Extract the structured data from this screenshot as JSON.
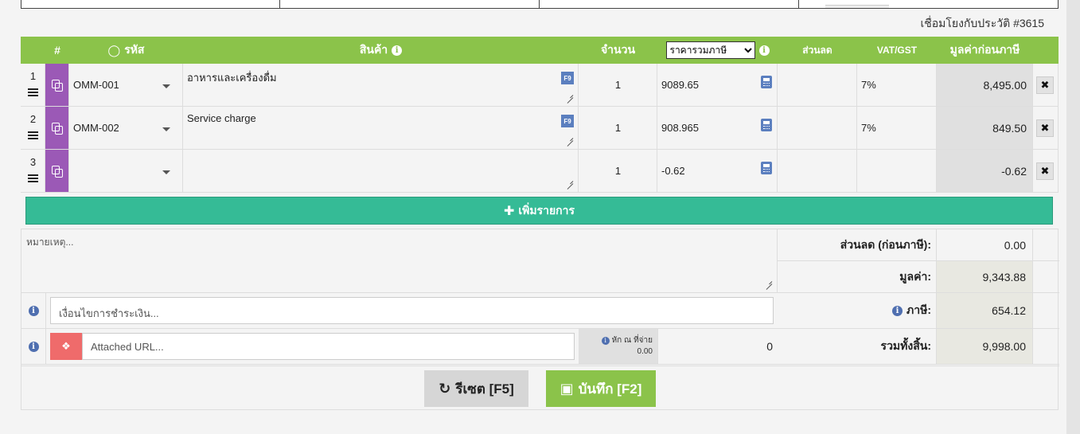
{
  "history_link": "เชื่อมโยงกับประวัติ #3615",
  "header": {
    "hash": "#",
    "code": "รหัส",
    "product": "สินค้า",
    "qty": "จำนวน",
    "price_mode_selected": "ราคารวมภาษี",
    "discount": "ส่วนลด",
    "vat": "VAT/GST",
    "amount": "มูลค่าก่อนภาษี"
  },
  "rows": [
    {
      "no": "1",
      "code": "OMM-001",
      "product": "อาหารและเครื่องดื่ม",
      "qty": "1",
      "price": "9089.65",
      "discount": "",
      "vat": "7%",
      "amount": "8,495.00",
      "f9": "F9"
    },
    {
      "no": "2",
      "code": "OMM-002",
      "product": "Service charge",
      "qty": "1",
      "price": "908.965",
      "discount": "",
      "vat": "7%",
      "amount": "849.50",
      "f9": "F9"
    },
    {
      "no": "3",
      "code": "",
      "product": "",
      "qty": "1",
      "price": "-0.62",
      "discount": "",
      "vat": "",
      "amount": "-0.62",
      "f9": ""
    }
  ],
  "add_row_label": "เพิ่มรายการ",
  "note_placeholder": "หมายเหตุ...",
  "payment_terms_placeholder": "เงื่อนไขการชำระเงิน...",
  "attached_url_placeholder": "Attached URL...",
  "withholding": {
    "label": "หัก ณ ที่จ่าย",
    "amount": "0.00",
    "value": "0"
  },
  "summary": {
    "discount_label": "ส่วนลด (ก่อนภาษี):",
    "discount_value": "0.00",
    "value_label": "มูลค่า:",
    "value_value": "9,343.88",
    "tax_label": "ภาษี:",
    "tax_value": "654.12",
    "total_label": "รวมทั้งสิ้น:",
    "total_value": "9,998.00"
  },
  "buttons": {
    "reset": "รีเซต [F5]",
    "save": "บันทึก [F2]"
  },
  "colors": {
    "header_green": "#8bc34a",
    "add_teal": "#35bb96",
    "copy_purple": "#9b59b6",
    "dropbox_red": "#ef6b6b"
  }
}
